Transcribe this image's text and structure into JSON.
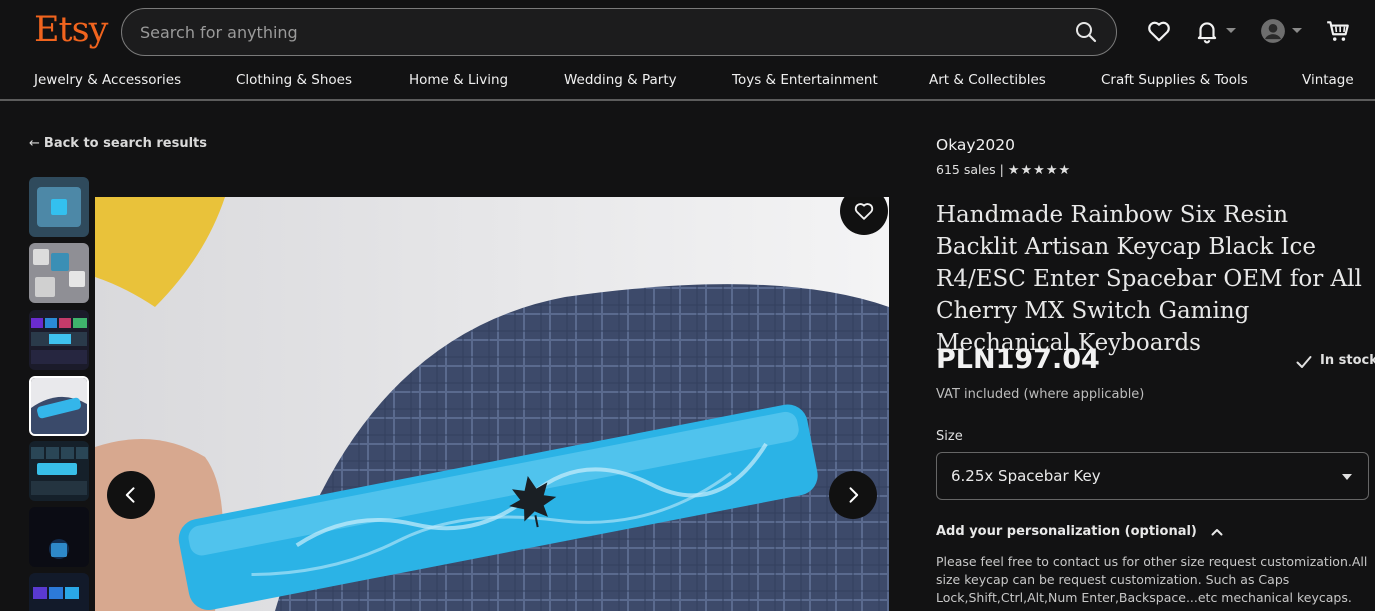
{
  "header": {
    "logo": "Etsy",
    "search_placeholder": "Search for anything"
  },
  "categories": [
    "Jewelry & Accessories",
    "Clothing & Shoes",
    "Home & Living",
    "Wedding & Party",
    "Toys & Entertainment",
    "Art & Collectibles",
    "Craft Supplies & Tools",
    "Vintage"
  ],
  "gallery": {
    "back_label": "Back to search results",
    "selected_thumb_index": 3
  },
  "product": {
    "shop_name": "Okay2020",
    "sales": "615 sales",
    "separator": "|",
    "stars": "★★★★★",
    "title": "Handmade Rainbow Six Resin Backlit Artisan Keycap Black Ice R4/ESC Enter Spacebar OEM for All Cherry MX Switch Gaming Mechanical Keyboards",
    "price": "PLN197.04",
    "stock": "In stock",
    "vat": "VAT included (where applicable)",
    "size_label": "Size",
    "size_value": "6.25x Spacebar Key",
    "personalization_label": "Add your personalization (optional)",
    "personalization_note": "Please feel free to contact us for other size request customization.All size keycap can be request customization. Such as Caps Lock,Shift,Ctrl,Alt,Num Enter,Backspace...etc mechanical keycaps."
  },
  "colors": {
    "brand": "#f1641e",
    "background": "#121213",
    "keycap": "#2bb3e6"
  }
}
